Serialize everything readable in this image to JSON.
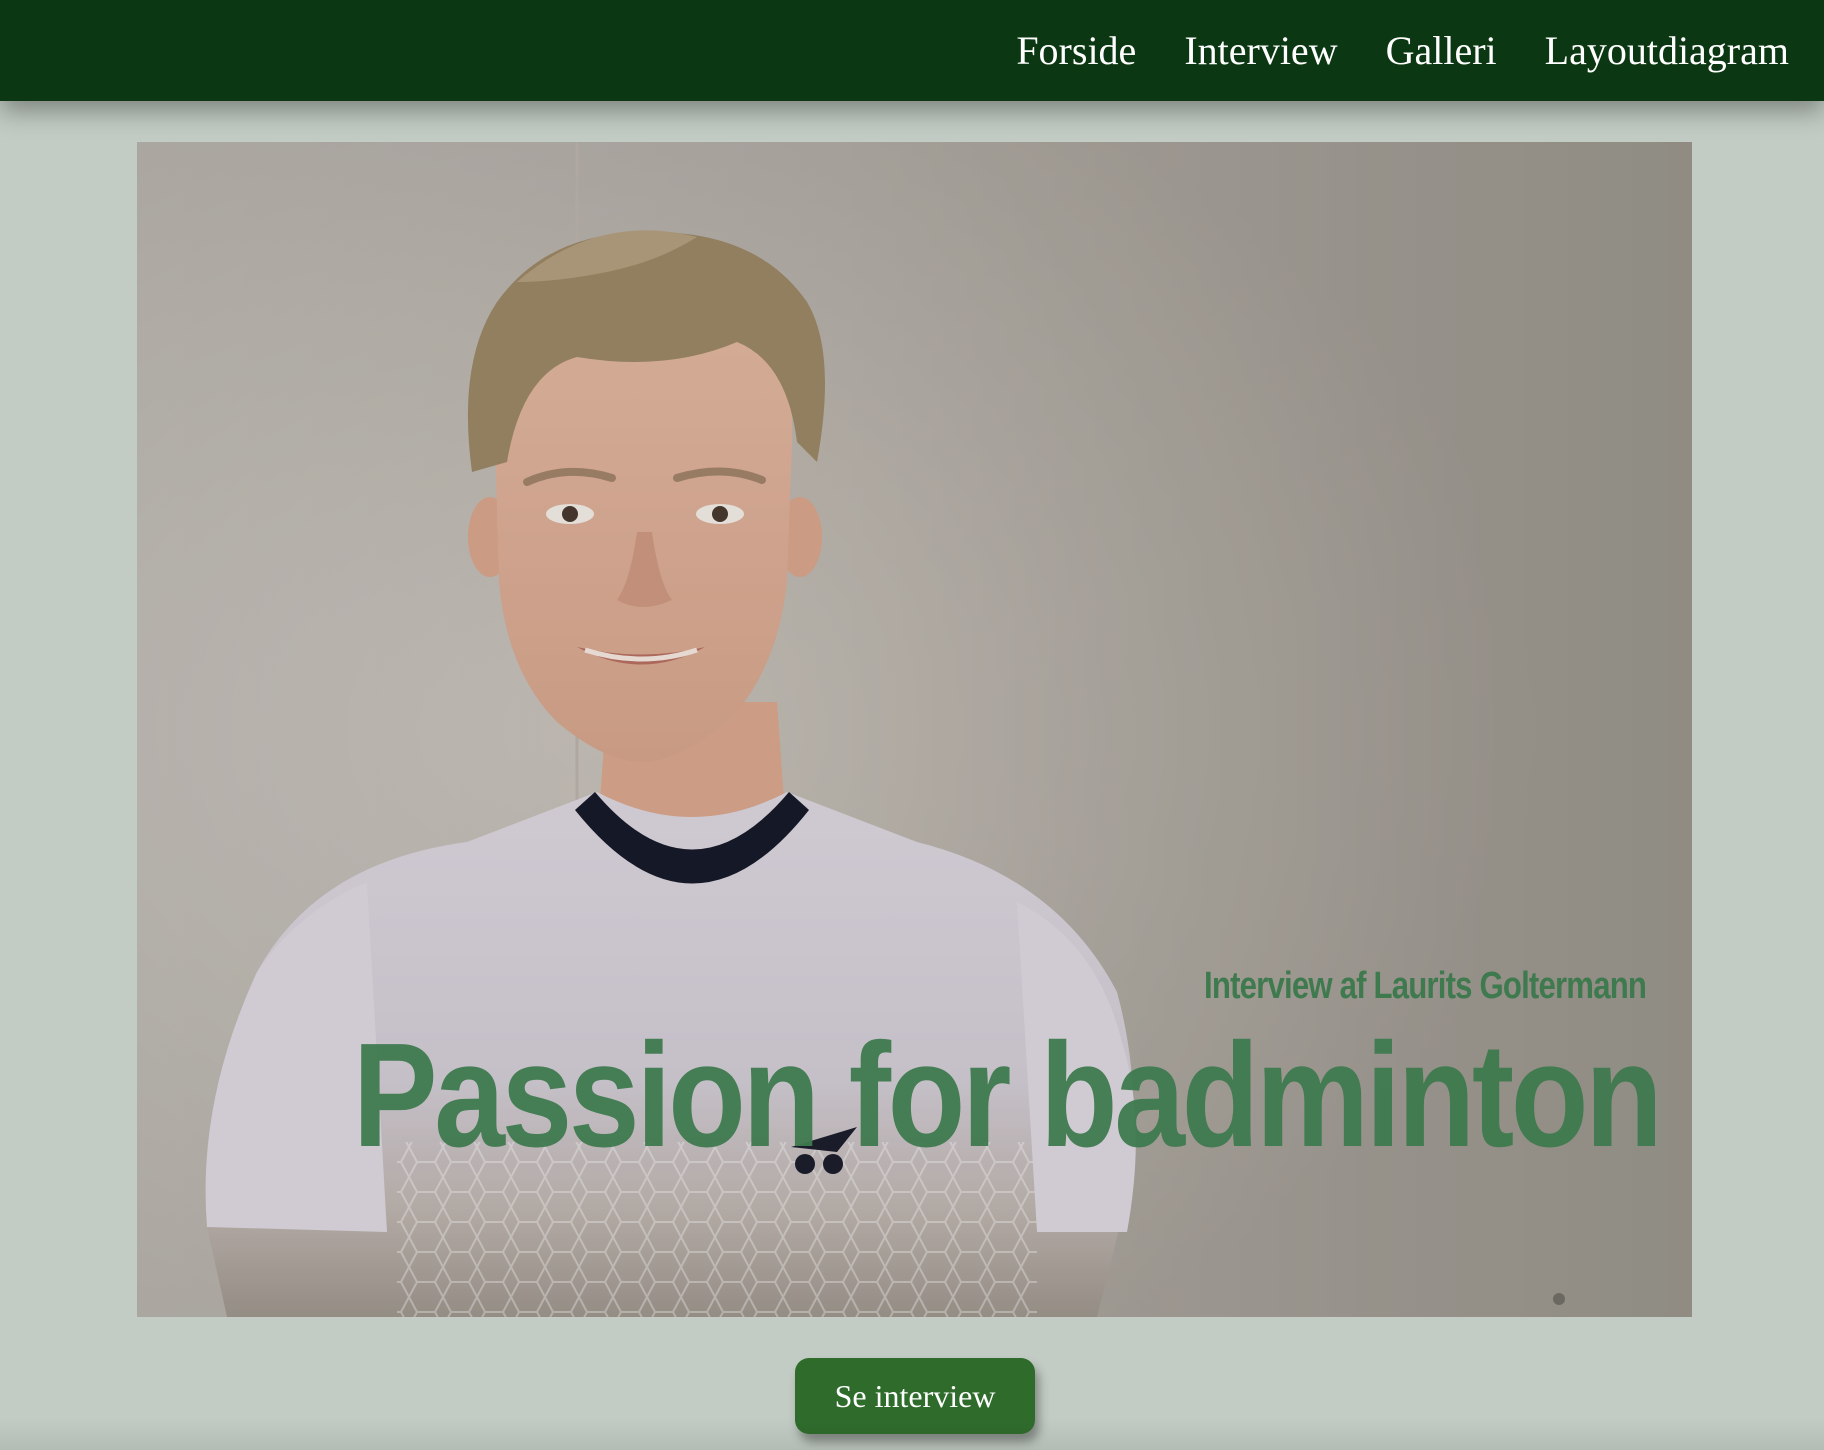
{
  "nav": {
    "items": [
      {
        "label": "Forside"
      },
      {
        "label": "Interview"
      },
      {
        "label": "Galleri"
      },
      {
        "label": "Layoutdiagram"
      }
    ]
  },
  "hero": {
    "subtitle": "Interview af Laurits Goltermann",
    "title": "Passion for badminton",
    "image_semantic": "boy-in-badminton-shirt-photo"
  },
  "cta": {
    "label": "Se interview"
  },
  "colors": {
    "nav_bg": "#0b3812",
    "page_bg": "#c2ccc4",
    "accent_text": "#3f7a4f",
    "button_bg": "#2f6c2c"
  }
}
